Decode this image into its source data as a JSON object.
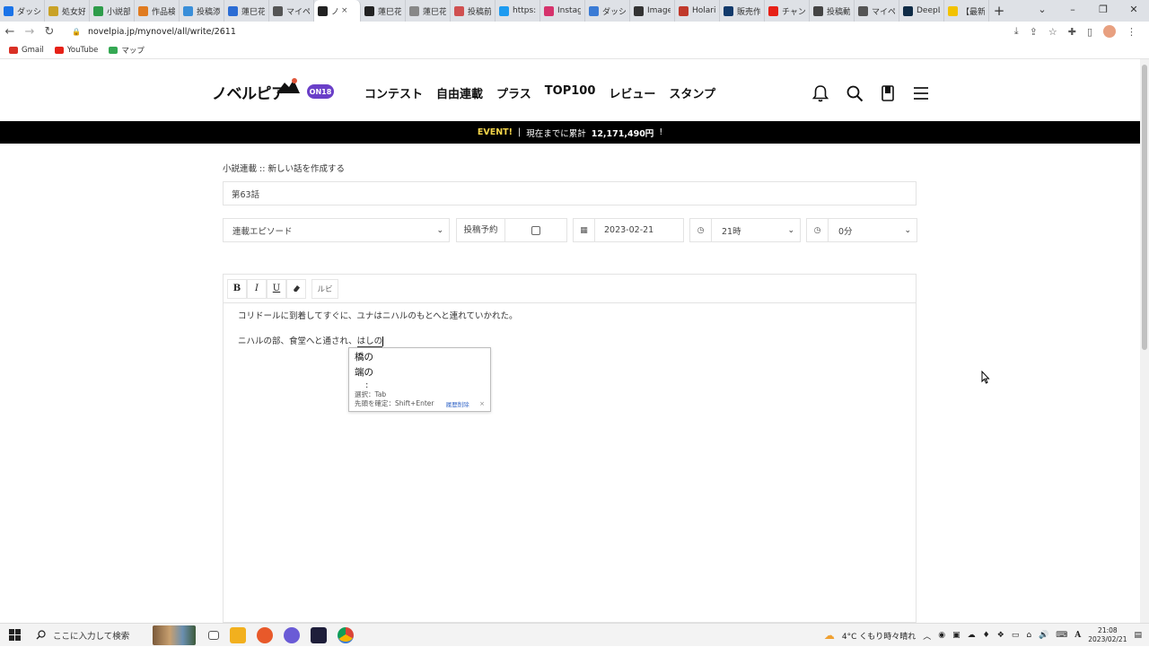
{
  "browser": {
    "tabs": [
      {
        "title": "ダッシュ",
        "color": "#1a73e8"
      },
      {
        "title": "処女好",
        "color": "#c9a227"
      },
      {
        "title": "小説部",
        "color": "#2e9c4a"
      },
      {
        "title": "作品検",
        "color": "#e07b20"
      },
      {
        "title": "投稿添",
        "color": "#3a8fd9"
      },
      {
        "title": "蓮巳花",
        "color": "#2b6cd4"
      },
      {
        "title": "マイペ",
        "color": "#555555"
      },
      {
        "title": "ノ",
        "color": "#222222",
        "active": true
      },
      {
        "title": "蓮巳花",
        "color": "#222222"
      },
      {
        "title": "蓮巳花",
        "color": "#888888"
      },
      {
        "title": "投稿前",
        "color": "#d05050"
      },
      {
        "title": "https:",
        "color": "#1d9bf0"
      },
      {
        "title": "Instag",
        "color": "#d6336c"
      },
      {
        "title": "ダッシュ",
        "color": "#3a7bd5"
      },
      {
        "title": "Image",
        "color": "#333333"
      },
      {
        "title": "Holari",
        "color": "#c0392b"
      },
      {
        "title": "販売作",
        "color": "#123a6b"
      },
      {
        "title": "チャンネ",
        "color": "#e62117"
      },
      {
        "title": "投稿動",
        "color": "#444444"
      },
      {
        "title": "マイペ",
        "color": "#555555"
      },
      {
        "title": "DeepL",
        "color": "#0f2b46"
      },
      {
        "title": "【最新",
        "color": "#f2c200"
      }
    ],
    "tab_close": "×",
    "new_tab": "+",
    "url": "novelpia.jp/mynovel/all/write/2611",
    "bookmarks": [
      {
        "label": "Gmail",
        "color": "#d93025"
      },
      {
        "label": "YouTube",
        "color": "#e62117"
      },
      {
        "label": "マップ",
        "color": "#34a853"
      }
    ]
  },
  "site": {
    "logo": "ノベルピア",
    "badge": "ON18",
    "nav": [
      "コンテスト",
      "自由連載",
      "プラス",
      "TOP100",
      "レビュー",
      "スタンプ"
    ],
    "event_label": "EVENT!",
    "event_sep": "|",
    "event_text": "現在までに累計",
    "event_amount": "12,171,490円",
    "event_suffix": "!"
  },
  "form": {
    "breadcrumb": "小説連載 :: 新しい話を作成する",
    "title_value": "第63話",
    "episode_type": "連載エピソード",
    "schedule_label": "投稿予約",
    "date": "2023-02-21",
    "hour": "21時",
    "minute": "0分"
  },
  "toolbar": {
    "bold": "B",
    "italic": "I",
    "underline": "U",
    "ruby": "ルビ"
  },
  "editor": {
    "line1": "コリドールに到着してすぐに、ユナはニハルのもとへと連れていかれた。",
    "line2_prefix": "ニハルの部、食堂へと通され、",
    "composing": "はしの"
  },
  "ime": {
    "candidates": [
      "橋の",
      "端の"
    ],
    "more": ":",
    "hint_select": "選択：Tab",
    "hint_confirm": "先頭を確定：Shift+Enter",
    "delete_history": "履歴削除",
    "close": "×"
  },
  "taskbar": {
    "search_placeholder": "ここに入力して検索",
    "weather": "4°C くもり時々晴れ",
    "time": "21:08",
    "date": "2023/02/21"
  }
}
